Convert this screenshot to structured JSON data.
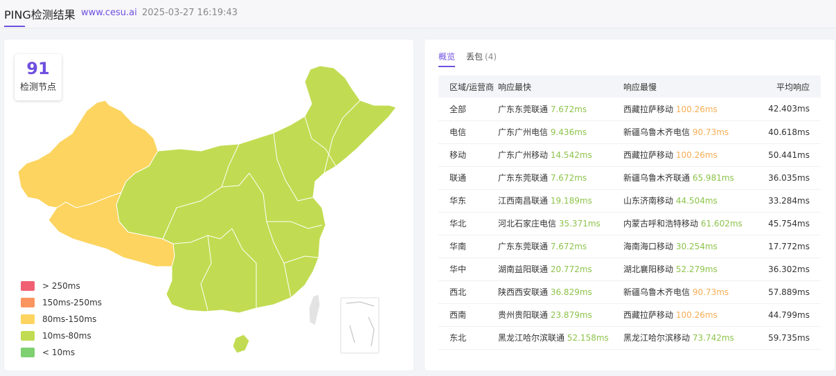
{
  "header": {
    "title": "PING检测结果",
    "site": "www.cesu.ai",
    "time": "2025-03-27 16:19:43"
  },
  "summary": {
    "count": "91",
    "count_label": "检测节点"
  },
  "map_colors": {
    "slow": "#fcd45f",
    "normal": "#c1dc52"
  },
  "legend": [
    {
      "label": "> 250ms",
      "color": "#f06073"
    },
    {
      "label": "150ms-250ms",
      "color": "#fb9560"
    },
    {
      "label": "80ms-150ms",
      "color": "#fcd45f"
    },
    {
      "label": "10ms-80ms",
      "color": "#c1dc52"
    },
    {
      "label": "< 10ms",
      "color": "#7ed070"
    }
  ],
  "tabs": [
    {
      "label": "概览",
      "count": ""
    },
    {
      "label": "丢包",
      "count": "(4)"
    }
  ],
  "table": {
    "headers": [
      "区域/运营商",
      "响应最快",
      "响应最慢",
      "平均响应"
    ],
    "rows": [
      {
        "region": "全部",
        "fast_node": "广东东莞联通",
        "fast_ms": "7.672ms",
        "slow_node": "西藏拉萨移动",
        "slow_ms": "100.26ms",
        "avg": "42.403ms"
      },
      {
        "region": "电信",
        "fast_node": "广东广州电信",
        "fast_ms": "9.436ms",
        "slow_node": "新疆乌鲁木齐电信",
        "slow_ms": "90.73ms",
        "avg": "40.618ms"
      },
      {
        "region": "移动",
        "fast_node": "广东广州移动",
        "fast_ms": "14.542ms",
        "slow_node": "西藏拉萨移动",
        "slow_ms": "100.26ms",
        "avg": "50.441ms"
      },
      {
        "region": "联通",
        "fast_node": "广东东莞联通",
        "fast_ms": "7.672ms",
        "slow_node": "新疆乌鲁木齐联通",
        "slow_ms": "65.981ms",
        "avg": "36.035ms"
      },
      {
        "region": "华东",
        "fast_node": "江西南昌联通",
        "fast_ms": "19.189ms",
        "slow_node": "山东济南移动",
        "slow_ms": "44.504ms",
        "avg": "33.284ms"
      },
      {
        "region": "华北",
        "fast_node": "河北石家庄电信",
        "fast_ms": "35.371ms",
        "slow_node": "内蒙古呼和浩特移动",
        "slow_ms": "61.602ms",
        "avg": "45.754ms"
      },
      {
        "region": "华南",
        "fast_node": "广东东莞联通",
        "fast_ms": "7.672ms",
        "slow_node": "海南海口移动",
        "slow_ms": "30.254ms",
        "avg": "17.772ms"
      },
      {
        "region": "华中",
        "fast_node": "湖南益阳联通",
        "fast_ms": "20.772ms",
        "slow_node": "湖北襄阳移动",
        "slow_ms": "52.279ms",
        "avg": "36.302ms"
      },
      {
        "region": "西北",
        "fast_node": "陕西西安联通",
        "fast_ms": "36.829ms",
        "slow_node": "新疆乌鲁木齐电信",
        "slow_ms": "90.73ms",
        "avg": "57.889ms"
      },
      {
        "region": "西南",
        "fast_node": "贵州贵阳联通",
        "fast_ms": "23.879ms",
        "slow_node": "西藏拉萨移动",
        "slow_ms": "100.26ms",
        "avg": "44.799ms"
      },
      {
        "region": "东北",
        "fast_node": "黑龙江哈尔滨联通",
        "fast_ms": "52.158ms",
        "slow_node": "黑龙江哈尔滨移动",
        "slow_ms": "73.742ms",
        "avg": "59.735ms"
      }
    ]
  }
}
